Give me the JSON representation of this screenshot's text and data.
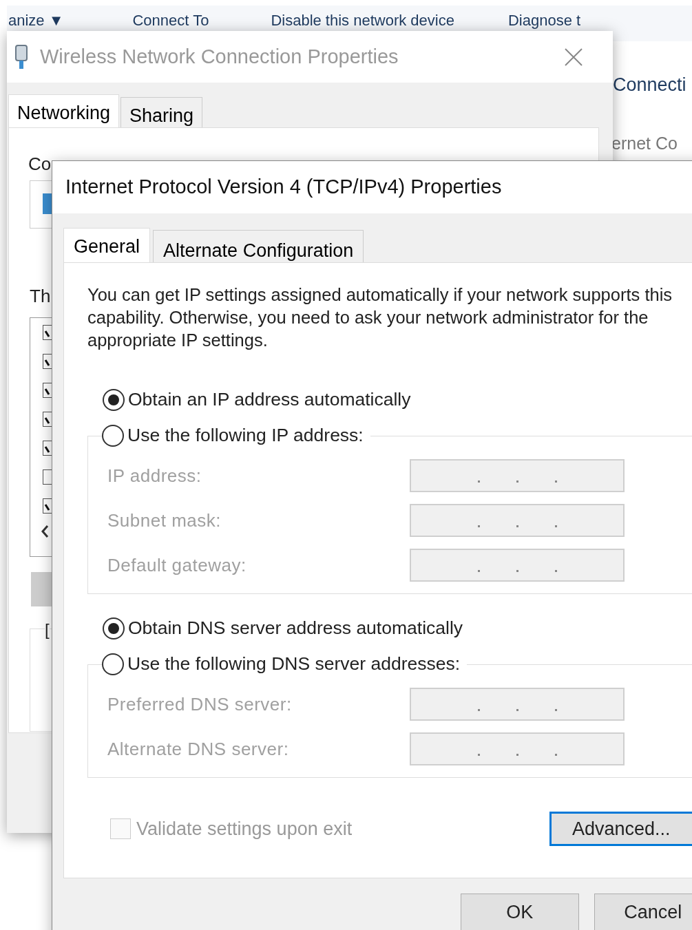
{
  "explorer_window": {
    "toolbar": [
      {
        "label": "anize ▼"
      },
      {
        "label": "Connect To"
      },
      {
        "label": "Disable this network device"
      },
      {
        "label": "Diagnose t"
      }
    ],
    "header": "Connecti",
    "subheader": "ernet Co"
  },
  "connection_properties": {
    "title": "Wireless Network Connection Properties",
    "tabs": [
      {
        "label": "Networking",
        "selected": true
      },
      {
        "label": "Sharing",
        "selected": false
      }
    ],
    "connect_label": "Co",
    "items_label": "Th",
    "items": [
      {
        "checked": true
      },
      {
        "checked": true
      },
      {
        "checked": true
      },
      {
        "checked": true
      },
      {
        "checked": true
      },
      {
        "checked": false
      },
      {
        "checked": true
      }
    ],
    "group_label": "["
  },
  "ipv4_properties": {
    "title": "Internet Protocol Version 4 (TCP/IPv4) Properties",
    "tabs": [
      {
        "label": "General",
        "selected": true
      },
      {
        "label": "Alternate Configuration",
        "selected": false
      }
    ],
    "description": "You can get IP settings assigned automatically if your network supports this capability. Otherwise, you need to ask your network administrator for the appropriate IP settings.",
    "sections": [
      {
        "auto_option": {
          "label": "Obtain an IP address automatically",
          "selected": true
        },
        "manual_option": {
          "label": "Use the following IP address:",
          "selected": false
        },
        "fields": [
          {
            "label": "IP address:",
            "disabled": true
          },
          {
            "label": "Subnet mask:",
            "disabled": true
          },
          {
            "label": "Default gateway:",
            "disabled": true
          }
        ]
      },
      {
        "auto_option": {
          "label": "Obtain DNS server address automatically",
          "selected": true
        },
        "manual_option": {
          "label": "Use the following DNS server addresses:",
          "selected": false
        },
        "fields": [
          {
            "label": "Preferred DNS server:",
            "disabled": true
          },
          {
            "label": "Alternate DNS server:",
            "disabled": true
          }
        ]
      }
    ],
    "validate": {
      "label": "Validate settings upon exit",
      "checked": false,
      "disabled": true
    },
    "advanced_button": "Advanced...",
    "buttons": [
      {
        "label": "OK"
      },
      {
        "label": "Cancel"
      }
    ]
  }
}
